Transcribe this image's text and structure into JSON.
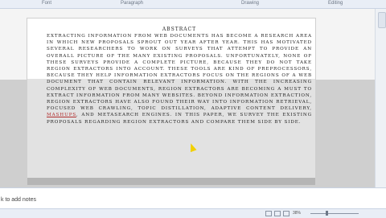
{
  "ribbon": {
    "groups": [
      "Font",
      "Paragraph",
      "Drawing",
      "Editing"
    ]
  },
  "slide": {
    "heading": "ABSTRACT",
    "body_before": "Extracting information from Web documents has become a research area in which new proposals sprout out year after year. This has motivated several researchers to work on surveys that attempt to provide an overall picture of the many existing proposals. Unfortunately, none of these surveys provide a complete picture, because they do not take region extractors into account. These tools are kind of preprocessors, because they help information extractors focus on the regions of a web document that contain relevant information. With the increasing complexity of web documents, region extractors are becoming a must to extract information from many websites. Beyond information extraction, region extractors have also found their way into information retrieval, focused web crawling, topic distillation, adaptive content delivery, ",
    "highlight": "mashups",
    "body_after": ", and metasearch engines. In this paper, we survey the existing proposals regarding region extractors and compare them side by side."
  },
  "notes": {
    "placeholder": "k to add notes"
  },
  "status": {
    "zoom": "38%"
  }
}
